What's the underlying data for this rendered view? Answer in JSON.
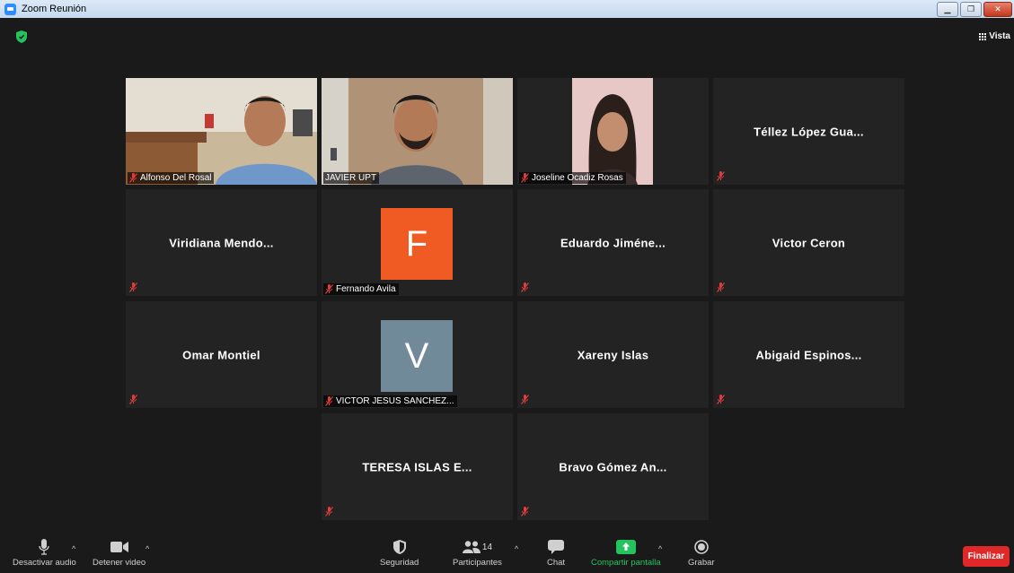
{
  "window": {
    "title": "Zoom Reunión"
  },
  "view_button": {
    "label": "Vista"
  },
  "participants_grid": [
    {
      "name": "Alfonso Del Rosal",
      "label": "Alfonso Del Rosal",
      "type": "video",
      "muted": true,
      "active": true
    },
    {
      "name": "JAVIER UPT",
      "label": "JAVIER UPT",
      "type": "video",
      "muted": false
    },
    {
      "name": "Joseline Ocadiz Rosas",
      "label": "Joseline Ocadiz Rosas",
      "type": "video",
      "muted": true
    },
    {
      "name": "Téllez López Gua...",
      "type": "name",
      "muted": true
    },
    {
      "name": "Viridiana Mendo...",
      "type": "name",
      "muted": true
    },
    {
      "name": "Fernando Avila",
      "label": "Fernando Avila",
      "type": "avatar",
      "initial": "F",
      "avatar_color": "#f05a23",
      "muted": true
    },
    {
      "name": "Eduardo Jiméne...",
      "type": "name",
      "muted": true
    },
    {
      "name": "Victor Ceron",
      "type": "name",
      "muted": true
    },
    {
      "name": "Omar Montiel",
      "type": "name",
      "muted": true
    },
    {
      "name": "VICTOR JESUS SANCHEZ...",
      "label": "VICTOR JESUS SANCHEZ...",
      "type": "avatar",
      "initial": "V",
      "avatar_color": "#708a9a",
      "muted": true
    },
    {
      "name": "Xareny Islas",
      "type": "name",
      "muted": true
    },
    {
      "name": "Abigaid Espinos...",
      "type": "name",
      "muted": true
    },
    {
      "name": "TERESA ISLAS E...",
      "type": "name",
      "muted": true
    },
    {
      "name": "Bravo Gómez An...",
      "type": "name",
      "muted": true
    }
  ],
  "toolbar": {
    "mute_label": "Desactivar audio",
    "video_label": "Detener video",
    "security_label": "Seguridad",
    "participants_label": "Participantes",
    "participants_count": "14",
    "chat_label": "Chat",
    "share_label": "Compartir pantalla",
    "record_label": "Grabar",
    "end_label": "Finalizar"
  },
  "colors": {
    "active_speaker": "#d5e84a",
    "share": "#23c45e",
    "end": "#e02828",
    "mute_icon": "#e03c3c"
  }
}
